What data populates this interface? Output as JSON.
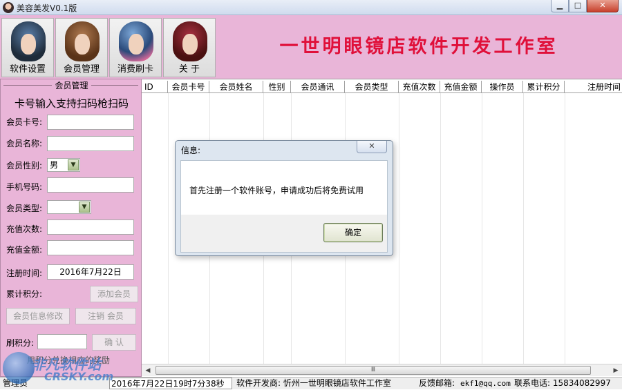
{
  "window": {
    "title": "美容美发V0.1版",
    "controls": {
      "minimize": "▁",
      "maximize": "□",
      "close": "✕"
    }
  },
  "nav": [
    {
      "label": "软件设置",
      "icon": "hair-model-1-icon"
    },
    {
      "label": "会员管理",
      "icon": "hair-model-2-icon"
    },
    {
      "label": "消费刷卡",
      "icon": "hair-model-3-icon"
    },
    {
      "label": "关 于",
      "icon": "hair-model-4-icon"
    }
  ],
  "banner": "一世明眼镜店软件开发工作室",
  "member_panel": {
    "group_title": "会员管理",
    "scan_hint": "卡号输入支持扫码枪扫码",
    "fields": {
      "card_no": {
        "label": "会员卡号:",
        "value": ""
      },
      "name": {
        "label": "会员名称:",
        "value": ""
      },
      "gender": {
        "label": "会员性别:",
        "value": "男"
      },
      "phone": {
        "label": "手机号码:",
        "value": ""
      },
      "type": {
        "label": "会员类型:",
        "value": ""
      },
      "recharge_count": {
        "label": "充值次数:",
        "value": ""
      },
      "recharge_amount": {
        "label": "充值金额:",
        "value": ""
      },
      "reg_time": {
        "label": "注册时间:",
        "value": "2016年7月22日"
      },
      "points": {
        "label": "累计积分:"
      }
    },
    "buttons": {
      "add": "添加会员",
      "edit": "会员信息修改",
      "cancel": "注销 会员",
      "confirm": "确 认"
    },
    "swipe_points": {
      "label": "刷积分:",
      "value": ""
    },
    "cut_text": "用积分兑换相应的奖励"
  },
  "grid": {
    "columns": [
      "ID",
      "会员卡号",
      "会员姓名",
      "性别",
      "会员通讯",
      "会员类型",
      "充值次数",
      "充值金额",
      "操作员",
      "累计积分",
      "注册时间"
    ],
    "scroll_grip": "Ⅲ"
  },
  "status": {
    "operator_label": "管理员",
    "time_value": "2016年7月22日19时7分38秒",
    "developer": "软件开发商: 忻州一世明眼镜店软件工作室",
    "feedback_label": "反馈邮箱:",
    "feedback_email": "ekf1@qq.com",
    "contact": "联系电话: 15834082997"
  },
  "dialog": {
    "title": "信息:",
    "message": "首先注册一个软件账号，申请成功后将免费试用",
    "ok": "确定",
    "close": "✕"
  },
  "watermark": {
    "name": "非凡软件站",
    "sub": "CRSKY.com"
  }
}
